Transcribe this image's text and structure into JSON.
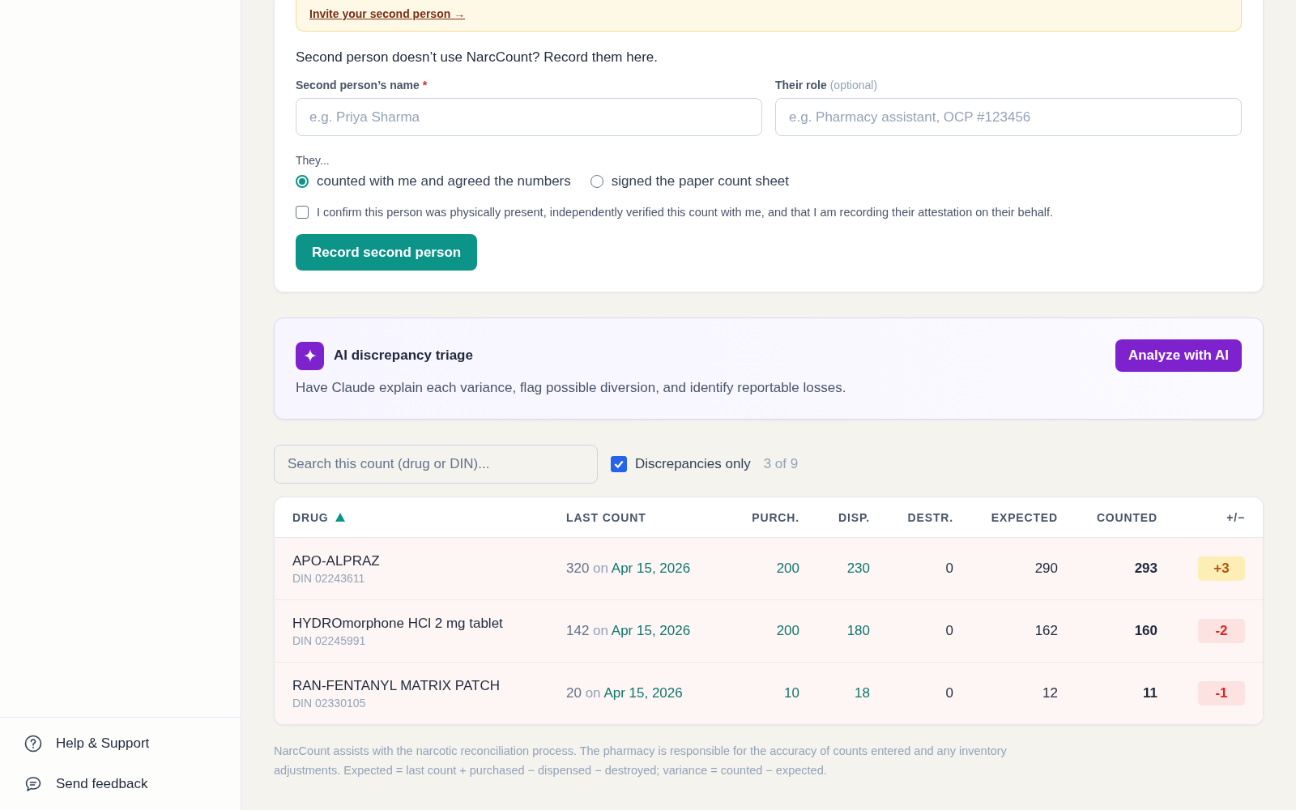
{
  "sidebar": {
    "footer_items": [
      {
        "label": "Help & Support",
        "kind": "help"
      },
      {
        "label": "Send feedback",
        "kind": "feedback"
      }
    ]
  },
  "attestation": {
    "invite_link": "Invite your second person →",
    "heading": "Second person doesn’t use NarcCount? Record them here.",
    "name_field": {
      "label": "Second person’s name",
      "required_mark": "*",
      "placeholder": "e.g. Priya Sharma"
    },
    "role_field": {
      "label": "Their role",
      "hint": "(optional)",
      "placeholder": "e.g. Pharmacy assistant, OCP #123456"
    },
    "they_label": "They...",
    "options": [
      {
        "label": "counted with me and agreed the numbers",
        "selected": true
      },
      {
        "label": "signed the paper count sheet",
        "selected": false
      }
    ],
    "confirm": {
      "label": "I confirm this person was physically present, independently verified this count with me, and that I am recording their attestation on their behalf.",
      "checked": false
    },
    "button": "Record second person"
  },
  "ai_triage": {
    "title": "AI discrepancy triage",
    "description": "Have Claude explain each variance, flag possible diversion, and identify reportable losses.",
    "button": "Analyze with AI"
  },
  "filter": {
    "search_placeholder": "Search this count (drug or DIN)...",
    "discrepancies_only": {
      "label": "Discrepancies only",
      "checked": true
    },
    "count": "3 of 9"
  },
  "table": {
    "columns": [
      "DRUG",
      "LAST COUNT",
      "PURCH.",
      "DISP.",
      "DESTR.",
      "EXPECTED",
      "COUNTED",
      "+/−"
    ],
    "rows": [
      {
        "drug": "APO-ALPRAZ",
        "din": "DIN 02243611",
        "last_count": "320",
        "on": "on",
        "date": "Apr 15, 2026",
        "purchased": "200",
        "dispensed": "230",
        "destroyed": "0",
        "expected": "290",
        "counted": "293",
        "variance": "+3",
        "overage": true
      },
      {
        "drug": "HYDROmorphone HCl 2 mg tablet",
        "din": "DIN 02245991",
        "last_count": "142",
        "on": "on",
        "date": "Apr 15, 2026",
        "purchased": "200",
        "dispensed": "180",
        "destroyed": "0",
        "expected": "162",
        "counted": "160",
        "variance": "-2",
        "overage": false
      },
      {
        "drug": "RAN-FENTANYL MATRIX PATCH",
        "din": "DIN 02330105",
        "last_count": "20",
        "on": "on",
        "date": "Apr 15, 2026",
        "purchased": "10",
        "dispensed": "18",
        "destroyed": "0",
        "expected": "12",
        "counted": "11",
        "variance": "-1",
        "overage": false
      }
    ]
  },
  "disclaimer": "NarcCount assists with the narcotic reconciliation process. The pharmacy is responsible for the accuracy of counts entered and any inventory adjustments. Expected = last count + purchased − dispensed − destroyed; variance = counted − expected."
}
